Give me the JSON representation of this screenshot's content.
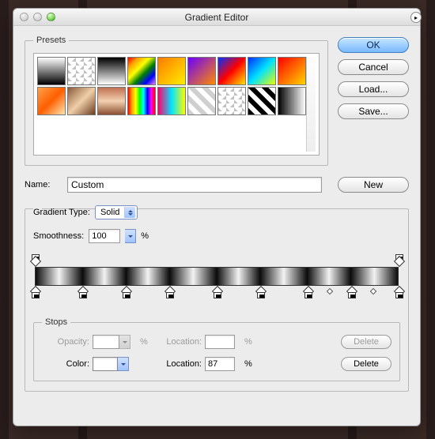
{
  "window": {
    "title": "Gradient Editor"
  },
  "buttons": {
    "ok": "OK",
    "cancel": "Cancel",
    "load": "Load...",
    "save": "Save...",
    "new": "New",
    "delete": "Delete"
  },
  "presets": {
    "legend": "Presets"
  },
  "name": {
    "label": "Name:",
    "value": "Custom"
  },
  "gradient": {
    "type_label": "Gradient Type:",
    "type_value": "Solid",
    "smoothness_label": "Smoothness:",
    "smoothness_value": "100",
    "smoothness_unit": "%"
  },
  "stops": {
    "legend": "Stops",
    "opacity_label": "Opacity:",
    "opacity_value": "",
    "opacity_unit": "%",
    "opacity_location_label": "Location:",
    "opacity_location_value": "",
    "opacity_location_unit": "%",
    "color_label": "Color:",
    "color_location_label": "Location:",
    "color_location_value": "87",
    "color_location_unit": "%"
  },
  "gradient_stops": {
    "opacity": [
      0,
      100
    ],
    "color_positions": [
      0,
      13,
      25,
      37,
      50,
      62,
      75,
      87,
      100
    ],
    "midpoints": [
      81,
      93
    ],
    "bar_css": "linear-gradient(90deg,#0b0b0b 0%,#f2f2f2 6.5%,#0b0b0b 13%,#f2f2f2 19%,#0b0b0b 25%,#f2f2f2 31%,#0b0b0b 37%,#f2f2f2 43.5%,#0b0b0b 50%,#f2f2f2 56%,#0b0b0b 62%,#f2f2f2 68.5%,#0b0b0b 75%,#f2f2f2 81%,#0b0b0b 87%,#f2f2f2 93.5%,#0b0b0b 100%)"
  }
}
